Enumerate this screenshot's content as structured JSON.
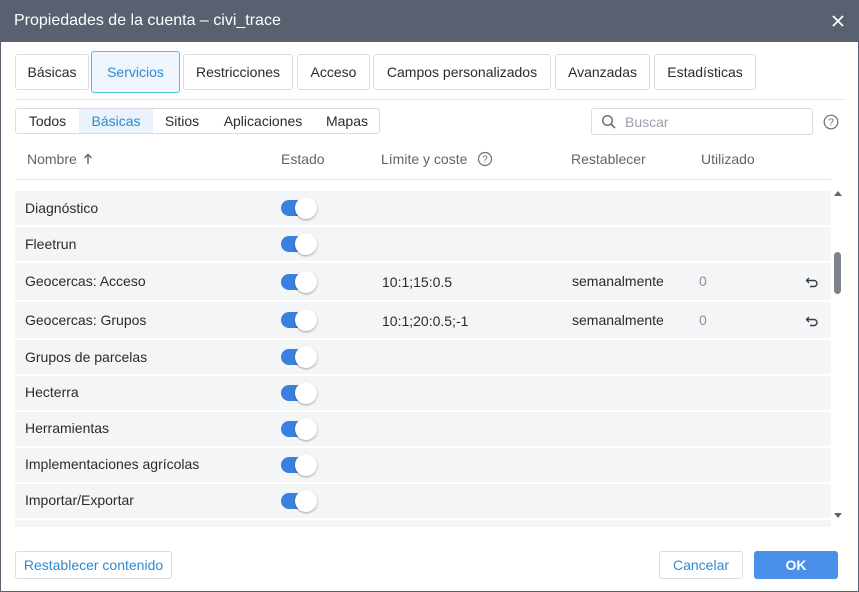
{
  "window": {
    "title": "Propiedades de la cuenta – civi_trace"
  },
  "tabs": [
    {
      "label": "Básicas"
    },
    {
      "label": "Servicios"
    },
    {
      "label": "Restricciones"
    },
    {
      "label": "Acceso"
    },
    {
      "label": "Campos personalizados"
    },
    {
      "label": "Avanzadas"
    },
    {
      "label": "Estadísticas"
    }
  ],
  "active_tab": "Servicios",
  "subtabs": [
    {
      "label": "Todos"
    },
    {
      "label": "Básicas"
    },
    {
      "label": "Sitios"
    },
    {
      "label": "Aplicaciones"
    },
    {
      "label": "Mapas"
    }
  ],
  "active_subtab": "Básicas",
  "search": {
    "placeholder": "Buscar",
    "value": ""
  },
  "table": {
    "headers": {
      "name": "Nombre",
      "status": "Estado",
      "limit": "Límite y coste",
      "reset": "Restablecer",
      "used": "Utilizado"
    },
    "sort": "ascending",
    "rows": [
      {
        "name": "Diagnóstico",
        "enabled": true,
        "limit": "",
        "reset": "",
        "used": ""
      },
      {
        "name": "Fleetrun",
        "enabled": true,
        "limit": "",
        "reset": "",
        "used": ""
      },
      {
        "name": "Geocercas: Acceso",
        "enabled": true,
        "limit": "10:1;15:0.5",
        "reset": "semanalmente",
        "used": "0"
      },
      {
        "name": "Geocercas: Grupos",
        "enabled": true,
        "limit": "10:1;20:0.5;-1",
        "reset": "semanalmente",
        "used": "0"
      },
      {
        "name": "Grupos de parcelas",
        "enabled": true,
        "limit": "",
        "reset": "",
        "used": ""
      },
      {
        "name": "Hecterra",
        "enabled": true,
        "limit": "",
        "reset": "",
        "used": ""
      },
      {
        "name": "Herramientas",
        "enabled": true,
        "limit": "",
        "reset": "",
        "used": ""
      },
      {
        "name": "Implementaciones agrícolas",
        "enabled": true,
        "limit": "",
        "reset": "",
        "used": ""
      },
      {
        "name": "Importar/Exportar",
        "enabled": true,
        "limit": "",
        "reset": "",
        "used": ""
      }
    ]
  },
  "footer": {
    "reset_label": "Restablecer contenido",
    "cancel_label": "Cancelar",
    "ok_label": "OK"
  },
  "colors": {
    "titlebar": "#596171",
    "accent": "#2f8ad1",
    "toggle_on": "#3b7fe0",
    "ok_button": "#4a90e8",
    "row_bg": "#f4f5f6"
  }
}
